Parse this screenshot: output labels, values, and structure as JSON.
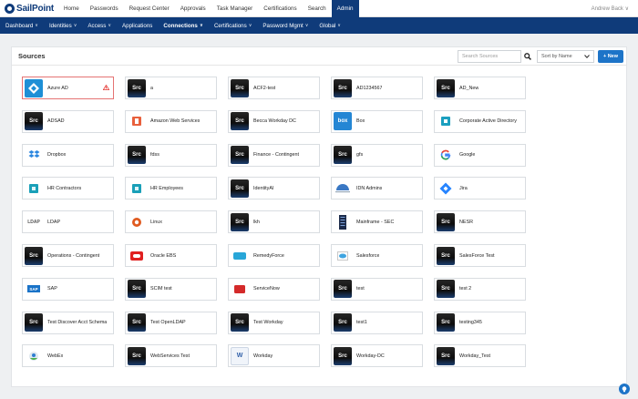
{
  "brand": {
    "name": "SailPoint"
  },
  "topnav": {
    "items": [
      "Home",
      "Passwords",
      "Request Center",
      "Approvals",
      "Task Manager",
      "Certifications",
      "Search",
      "Admin"
    ],
    "active_index": 7,
    "user": "Andrew Back ∨"
  },
  "subnav": {
    "items": [
      {
        "label": "Dashboard",
        "chevron": true
      },
      {
        "label": "Identities",
        "chevron": true
      },
      {
        "label": "Access",
        "chevron": true
      },
      {
        "label": "Applications",
        "chevron": false
      },
      {
        "label": "Connections",
        "chevron": true
      },
      {
        "label": "Certifications",
        "chevron": true
      },
      {
        "label": "Password Mgmt",
        "chevron": true
      },
      {
        "label": "Global",
        "chevron": true
      }
    ],
    "active_index": 4,
    "chevron_glyph": "∨"
  },
  "panel": {
    "title": "Sources",
    "search_placeholder": "Search Sources",
    "sort_label": "Sort by Name",
    "new_label": "+ New"
  },
  "sources": [
    {
      "name": "Azure AD",
      "icon": "azure-ad",
      "warning": true
    },
    {
      "name": "a",
      "icon": "src"
    },
    {
      "name": "ACF2-test",
      "icon": "src"
    },
    {
      "name": "AD1234567",
      "icon": "src"
    },
    {
      "name": "AD_New",
      "icon": "src"
    },
    {
      "name": "ADSAD",
      "icon": "src"
    },
    {
      "name": "Amazon Web Services",
      "icon": "aws"
    },
    {
      "name": "Becca Workday DC",
      "icon": "src"
    },
    {
      "name": "Box",
      "icon": "box"
    },
    {
      "name": "Corporate Active Directory",
      "icon": "corp-ad"
    },
    {
      "name": "Dropbox",
      "icon": "dropbox"
    },
    {
      "name": "fdss",
      "icon": "src"
    },
    {
      "name": "Finance - Contingent",
      "icon": "src"
    },
    {
      "name": "gfs",
      "icon": "src"
    },
    {
      "name": "Google",
      "icon": "google"
    },
    {
      "name": "HR Contractors",
      "icon": "hr"
    },
    {
      "name": "HR Employees",
      "icon": "hr"
    },
    {
      "name": "IdentityAI",
      "icon": "src"
    },
    {
      "name": "IDN Admins",
      "icon": "idn"
    },
    {
      "name": "Jira",
      "icon": "jira"
    },
    {
      "name": "LDAP",
      "icon": "ldap"
    },
    {
      "name": "Linux",
      "icon": "linux"
    },
    {
      "name": "lkh",
      "icon": "src"
    },
    {
      "name": "Mainframe - SEC",
      "icon": "mainframe"
    },
    {
      "name": "NESR",
      "icon": "src"
    },
    {
      "name": "Operations - Contingent",
      "icon": "src"
    },
    {
      "name": "Oracle EBS",
      "icon": "oracle"
    },
    {
      "name": "RemedyForce",
      "icon": "remedyforce"
    },
    {
      "name": "Salesforce",
      "icon": "salesforce"
    },
    {
      "name": "SalesForce Test",
      "icon": "src"
    },
    {
      "name": "SAP",
      "icon": "sap"
    },
    {
      "name": "SCIM test",
      "icon": "src"
    },
    {
      "name": "ServiceNow",
      "icon": "servicenow"
    },
    {
      "name": "test",
      "icon": "src"
    },
    {
      "name": "test 2",
      "icon": "src"
    },
    {
      "name": "Test Discover Acct Schema",
      "icon": "src"
    },
    {
      "name": "Test OpenLDAP",
      "icon": "src"
    },
    {
      "name": "Test Workday",
      "icon": "src"
    },
    {
      "name": "test1",
      "icon": "src"
    },
    {
      "name": "testing345",
      "icon": "src"
    },
    {
      "name": "WebEx",
      "icon": "webex"
    },
    {
      "name": "WebServices Test",
      "icon": "src"
    },
    {
      "name": "Workday",
      "icon": "workday"
    },
    {
      "name": "Workday-DC",
      "icon": "src"
    },
    {
      "name": "Workday_Test",
      "icon": "src"
    }
  ],
  "src_icon_text": "Src",
  "icon_text": {
    "box": "box",
    "sap": "SAP",
    "ldap": "LDAP",
    "workday": "W"
  },
  "colors": {
    "brand": "#0f3b7a",
    "accent": "#1d74c8",
    "error": "#e57373"
  }
}
